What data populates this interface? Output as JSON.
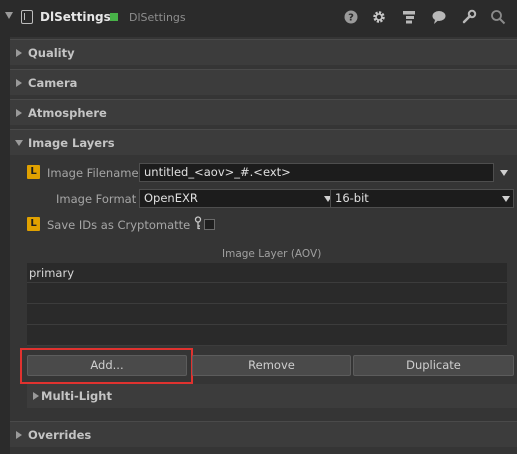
{
  "header": {
    "node_name": "DlSettings",
    "node_type": "DlSettings",
    "status_color": "#48b248",
    "icons": [
      "help-icon",
      "settings-gear-icon",
      "hierarchy-icon",
      "comment-icon",
      "wrench-icon",
      "search-icon"
    ]
  },
  "sections": {
    "quality": "Quality",
    "camera": "Camera",
    "atmosphere": "Atmosphere",
    "image_layers": "Image Layers",
    "multi_light": "Multi-Light",
    "overrides": "Overrides"
  },
  "image_layers": {
    "badge": "L",
    "filename_label": "Image Filename",
    "filename_value": "untitled_<aov>_#.<ext>",
    "format_label": "Image Format",
    "format_value": "OpenEXR",
    "bitdepth_value": "16-bit",
    "cryptomatte_label": "Save IDs as Cryptomatte",
    "cryptomatte_checked": false,
    "list_header": "Image Layer (AOV)",
    "layers": [
      "primary",
      "",
      "",
      ""
    ],
    "buttons": {
      "add": "Add...",
      "remove": "Remove",
      "duplicate": "Duplicate"
    }
  },
  "colors": {
    "badge": "#e0a100",
    "highlight": "#e0322f"
  }
}
